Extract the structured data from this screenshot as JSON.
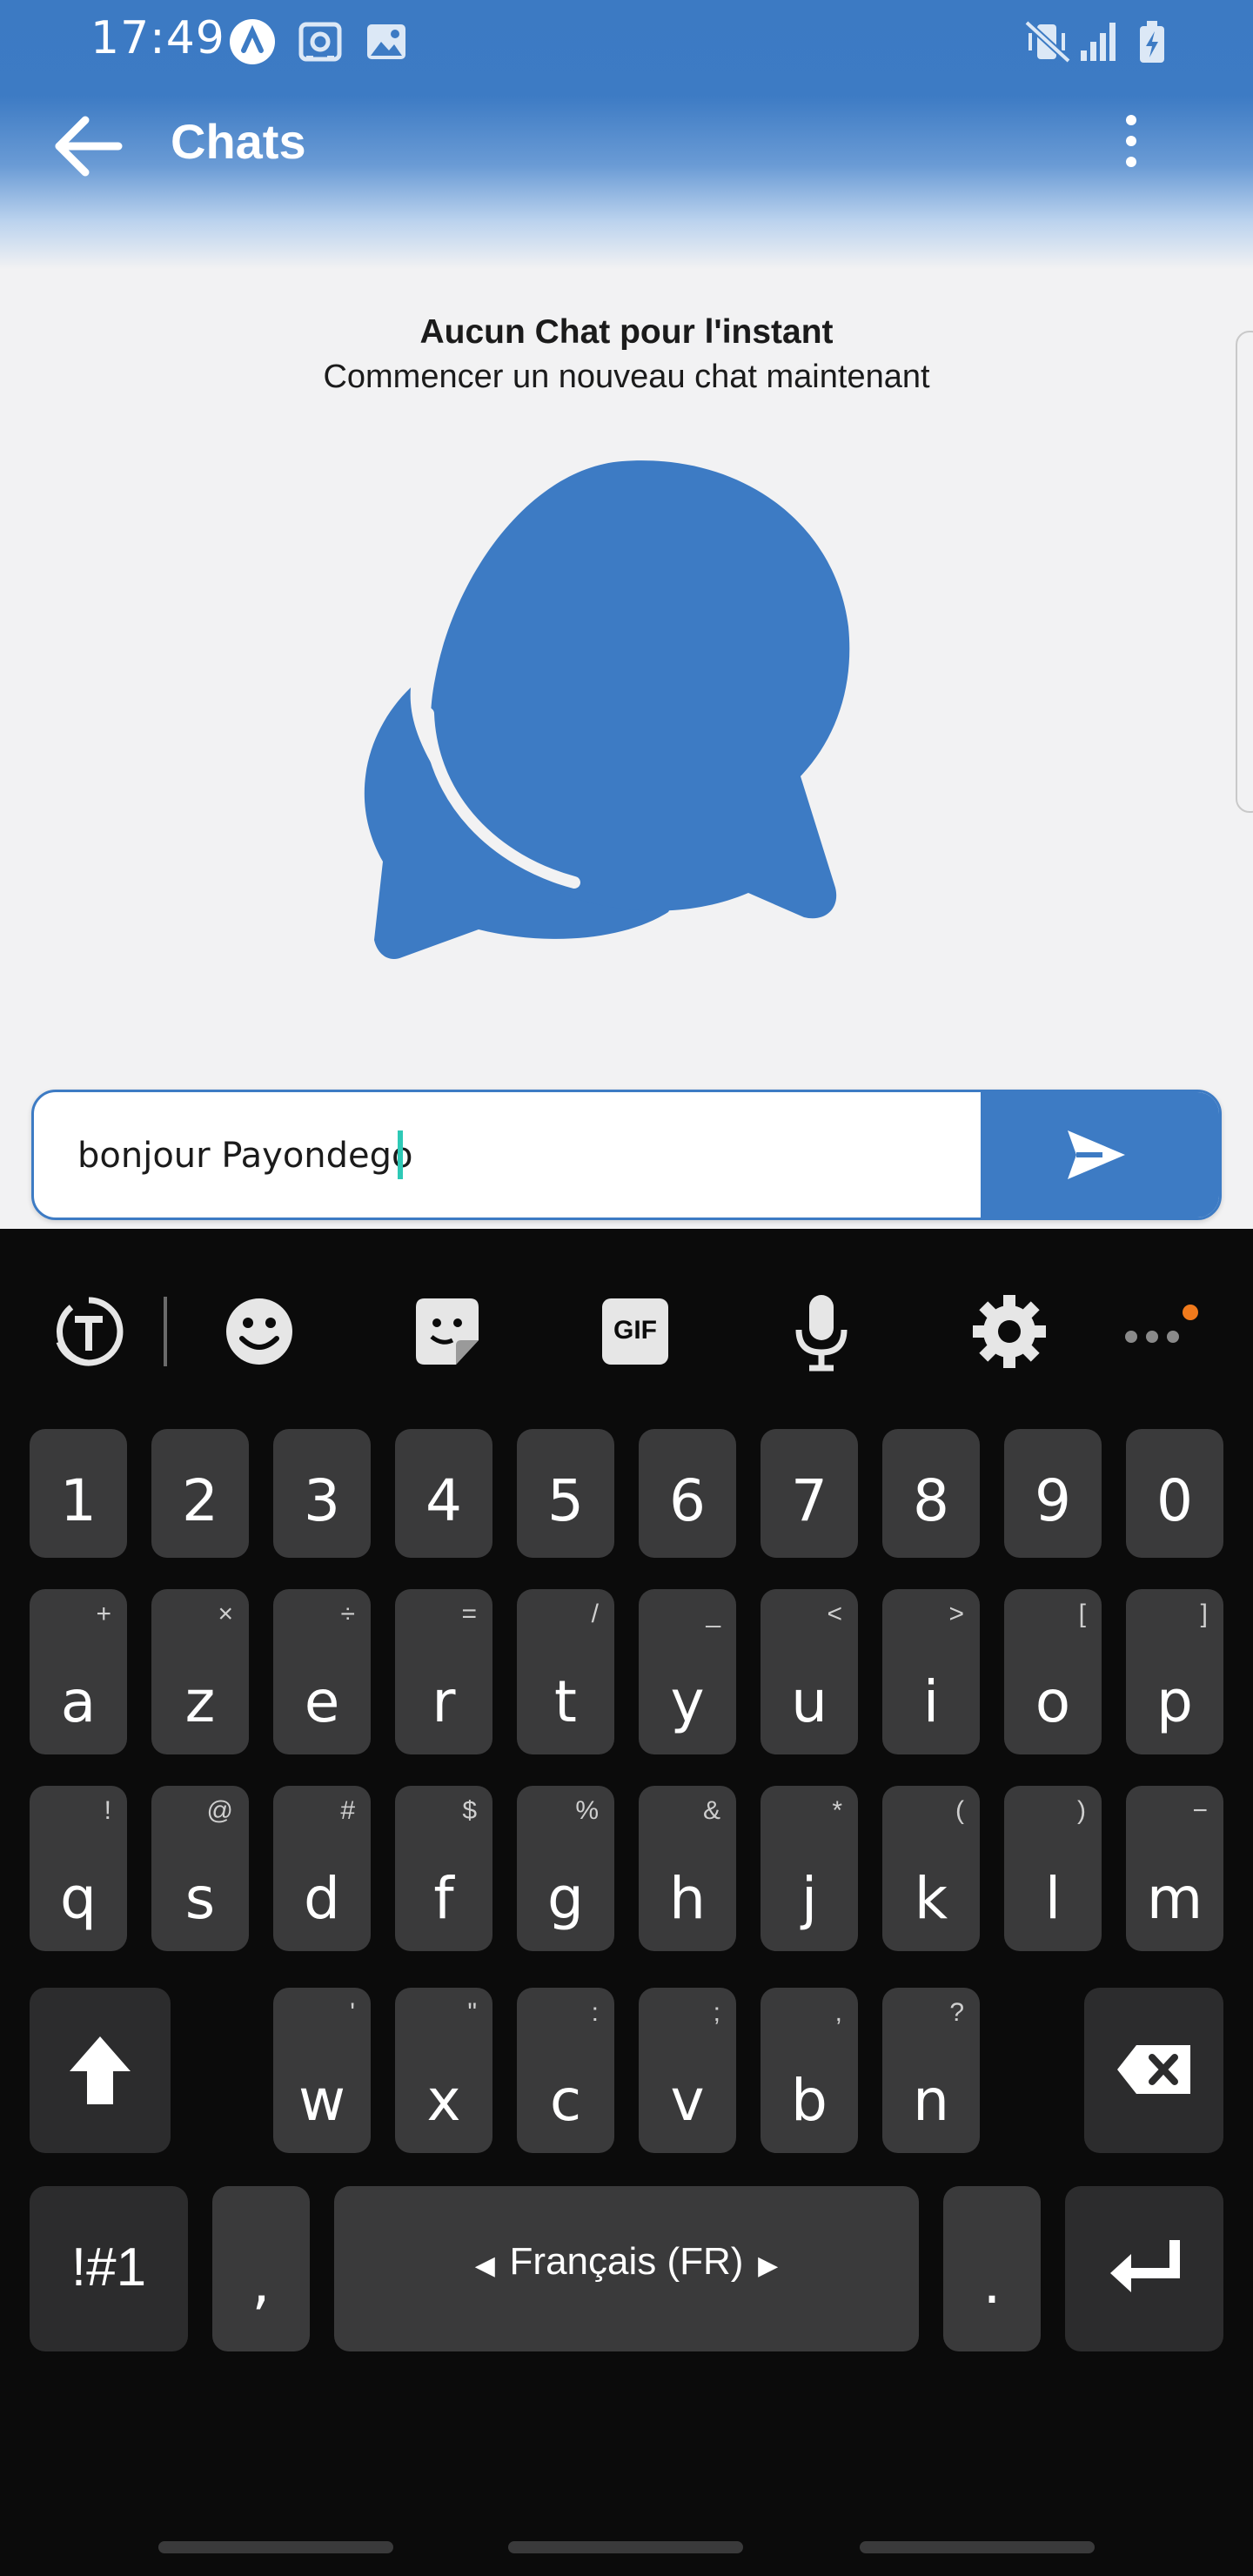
{
  "status_bar": {
    "time": "17:49",
    "icons": [
      "app-notification-icon",
      "screenshot-icon",
      "image-icon",
      "vibrate-mute-icon",
      "signal-icon",
      "battery-charging-icon"
    ]
  },
  "header": {
    "title": "Chats",
    "back_icon": "back-arrow-icon",
    "menu_icon": "more-vert-icon"
  },
  "empty_state": {
    "title": "Aucun Chat pour l'instant",
    "subtitle": "Commencer un nouveau chat maintenant",
    "illustration": "chat-bubbles-icon"
  },
  "composer": {
    "value": "bonjour Payondego",
    "send_icon": "send-icon"
  },
  "keyboard": {
    "toolbar": [
      "translate-icon",
      "emoji-icon",
      "sticker-icon",
      "gif-icon",
      "mic-icon",
      "settings-icon",
      "more-icon"
    ],
    "gif_label": "GIF",
    "number_row": [
      "1",
      "2",
      "3",
      "4",
      "5",
      "6",
      "7",
      "8",
      "9",
      "0"
    ],
    "row1": [
      {
        "k": "a",
        "h": "+"
      },
      {
        "k": "z",
        "h": "×"
      },
      {
        "k": "e",
        "h": "÷"
      },
      {
        "k": "r",
        "h": "="
      },
      {
        "k": "t",
        "h": "/"
      },
      {
        "k": "y",
        "h": "_"
      },
      {
        "k": "u",
        "h": "<"
      },
      {
        "k": "i",
        "h": ">"
      },
      {
        "k": "o",
        "h": "["
      },
      {
        "k": "p",
        "h": "]"
      }
    ],
    "row2": [
      {
        "k": "q",
        "h": "!"
      },
      {
        "k": "s",
        "h": "@"
      },
      {
        "k": "d",
        "h": "#"
      },
      {
        "k": "f",
        "h": "$"
      },
      {
        "k": "g",
        "h": "%"
      },
      {
        "k": "h",
        "h": "&"
      },
      {
        "k": "j",
        "h": "*"
      },
      {
        "k": "k",
        "h": "("
      },
      {
        "k": "l",
        "h": ")"
      },
      {
        "k": "m",
        "h": "−"
      }
    ],
    "row3": [
      {
        "k": "w",
        "h": "'"
      },
      {
        "k": "x",
        "h": "\""
      },
      {
        "k": "c",
        "h": ":"
      },
      {
        "k": "v",
        "h": ";"
      },
      {
        "k": "b",
        "h": ","
      },
      {
        "k": "n",
        "h": "?"
      }
    ],
    "symbols_label": "!#1",
    "comma": ",",
    "space_label": "Français (FR)",
    "period": "."
  },
  "colors": {
    "accent": "#3d7bc4",
    "caret": "#2ec9b6",
    "keyboard_bg": "#0b0b0b",
    "key_bg": "#3a3a3b",
    "notification_dot": "#f07a1c"
  }
}
